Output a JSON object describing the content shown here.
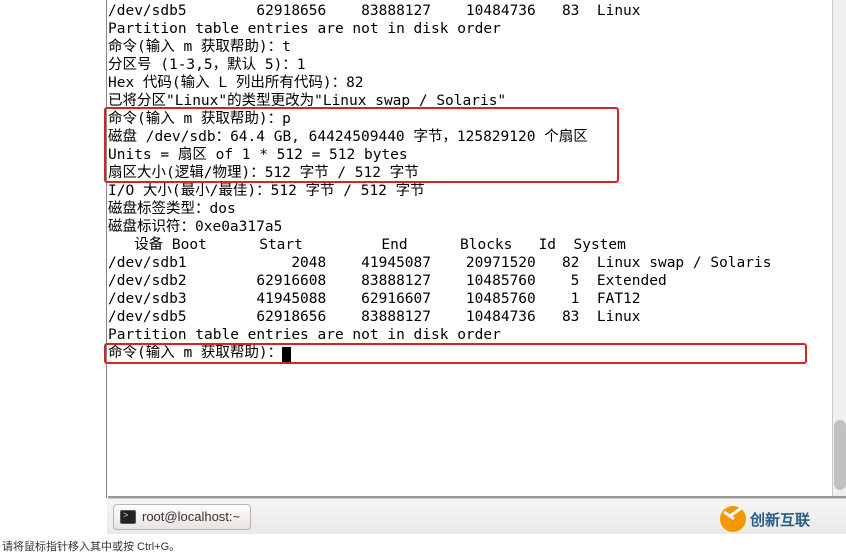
{
  "terminal": {
    "lines": [
      "/dev/sdb5        62918656    83888127    10484736   83  Linux",
      "",
      "Partition table entries are not in disk order",
      "",
      "命令(输入 m 获取帮助)：t",
      "分区号 (1-3,5，默认 5)：1",
      "Hex 代码(输入 L 列出所有代码)：82",
      "已将分区\"Linux\"的类型更改为\"Linux swap / Solaris\"",
      "",
      "命令(输入 m 获取帮助)：p",
      "",
      "磁盘 /dev/sdb：64.4 GB, 64424509440 字节，125829120 个扇区",
      "Units = 扇区 of 1 * 512 = 512 bytes",
      "扇区大小(逻辑/物理)：512 字节 / 512 字节",
      "I/O 大小(最小/最佳)：512 字节 / 512 字节",
      "磁盘标签类型：dos",
      "磁盘标识符：0xe0a317a5",
      "",
      "   设备 Boot      Start         End      Blocks   Id  System",
      "/dev/sdb1            2048    41945087    20971520   82  Linux swap / Solaris",
      "/dev/sdb2        62916608    83888127    10485760    5  Extended",
      "/dev/sdb3        41945088    62916607    10485760    1  FAT12",
      "/dev/sdb5        62918656    83888127    10484736   83  Linux",
      "",
      "Partition table entries are not in disk order",
      "",
      "命令(输入 m 获取帮助)："
    ]
  },
  "taskbar": {
    "title": "root@localhost:~"
  },
  "statusbar": {
    "text": "请将鼠标指针移入其中或按 Ctrl+G。"
  },
  "logo": {
    "text": "创新互联"
  }
}
